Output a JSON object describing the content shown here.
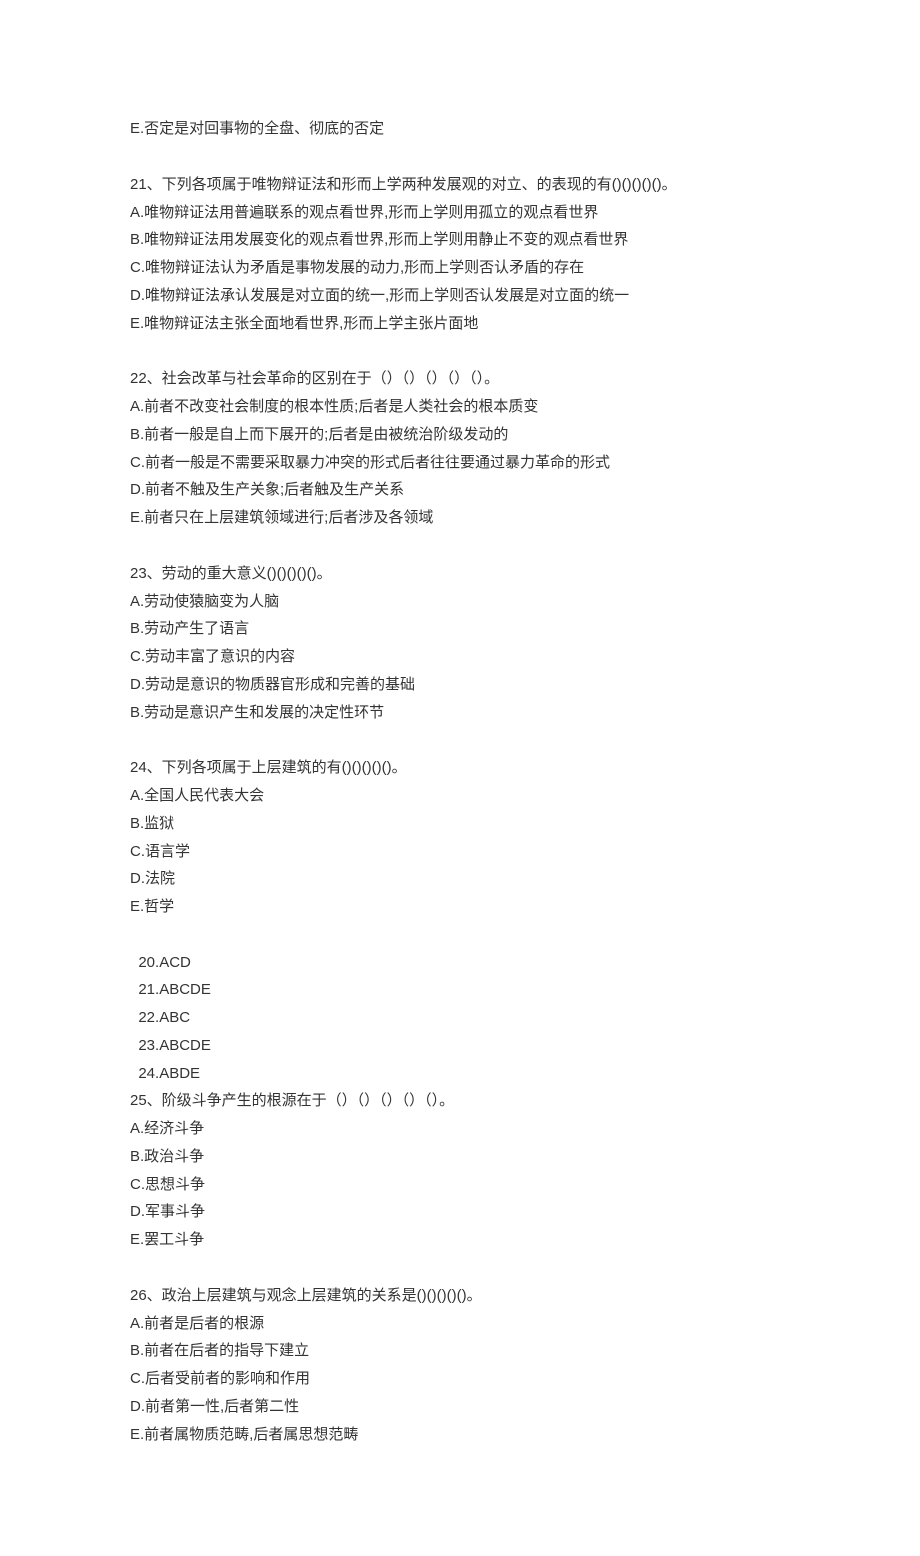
{
  "trailing": {
    "option_e": "E.否定是对回事物的全盘、彻底的否定"
  },
  "q21": {
    "stem": "21、下列各项属于唯物辩证法和形而上学两种发展观的对立、的表现的有()()()()()。",
    "a": "A.唯物辩证法用普遍联系的观点看世界,形而上学则用孤立的观点看世界",
    "b": "B.唯物辩证法用发展变化的观点看世界,形而上学则用静止不变的观点看世界",
    "c": "C.唯物辩证法认为矛盾是事物发展的动力,形而上学则否认矛盾的存在",
    "d": "D.唯物辩证法承认发展是对立面的统一,形而上学则否认发展是对立面的统一",
    "e": "E.唯物辩证法主张全面地看世界,形而上学主张片面地"
  },
  "q22": {
    "stem": "22、社会改革与社会革命的区别在于（）（）（）（）（）。",
    "a": "A.前者不改变社会制度的根本性质;后者是人类社会的根本质变",
    "b": "B.前者一般是自上而下展开的;后者是由被统治阶级发动的",
    "c": "C.前者一般是不需要采取暴力冲突的形式后者往往要通过暴力革命的形式",
    "d": "D.前者不触及生产关象;后者触及生产关系",
    "e": "E.前者只在上层建筑领域进行;后者涉及各领域"
  },
  "q23": {
    "stem": "23、劳动的重大意义()()()()()。",
    "a": "A.劳动使猿脑变为人脑",
    "b": "B.劳动产生了语言",
    "c": "C.劳动丰富了意识的内容",
    "d": "D.劳动是意识的物质器官形成和完善的基础",
    "e": "B.劳动是意识产生和发展的决定性环节"
  },
  "q24": {
    "stem": "24、下列各项属于上层建筑的有()()()()()。",
    "a": "A.全国人民代表大会",
    "b": "B.监狱",
    "c": "C.语言学",
    "d": "D.法院",
    "e": "E.哲学"
  },
  "answers": {
    "a20": "20.ACD",
    "a21": "21.ABCDE",
    "a22": "22.ABC",
    "a23": "23.ABCDE",
    "a24": "24.ABDE"
  },
  "q25": {
    "stem": "25、阶级斗争产生的根源在于（）（）（）（）（）。",
    "a": "A.经济斗争",
    "b": "B.政治斗争",
    "c": "C.思想斗争",
    "d": "D.军事斗争",
    "e": "E.罢工斗争"
  },
  "q26": {
    "stem": "26、政治上层建筑与观念上层建筑的关系是()()()()()。",
    "a": "A.前者是后者的根源",
    "b": "B.前者在后者的指导下建立",
    "c": "C.后者受前者的影响和作用",
    "d": "D.前者第一性,后者第二性",
    "e": "E.前者属物质范畴,后者属思想范畴"
  }
}
